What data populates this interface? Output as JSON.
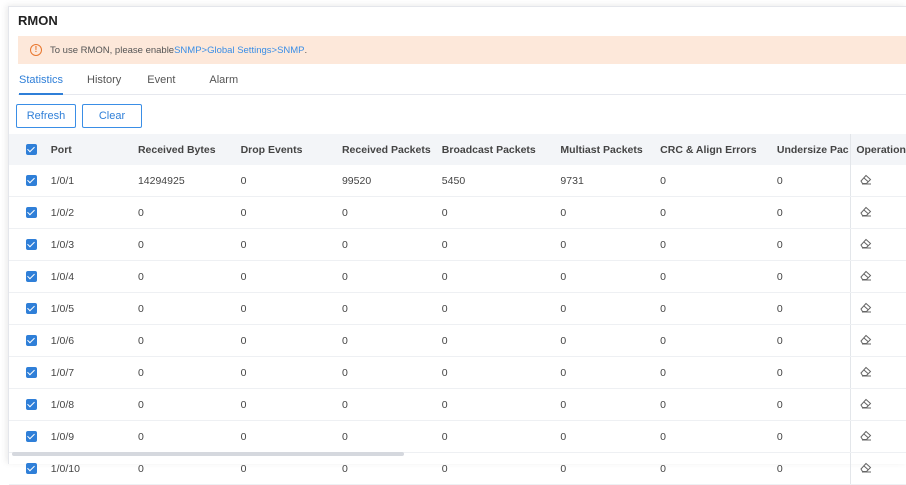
{
  "page": {
    "title": "RMON"
  },
  "notice": {
    "icon": "warning-circle-icon",
    "prefix": "To use RMON, please enable ",
    "link": "SNMP>Global Settings>SNMP",
    "suffix": "."
  },
  "tabs": [
    {
      "label": "Statistics",
      "active": true
    },
    {
      "label": "History",
      "active": false
    },
    {
      "label": "Event",
      "active": false
    },
    {
      "label": "Alarm",
      "active": false
    }
  ],
  "toolbar": {
    "refresh_label": "Refresh",
    "clear_label": "Clear"
  },
  "table": {
    "headers": {
      "port": "Port",
      "received_bytes": "Received Bytes",
      "drop_events": "Drop Events",
      "received_packets": "Received Packets",
      "broadcast_packets": "Broadcast Packets",
      "multicast_packets": "Multiast Packets",
      "crc_align_errors": "CRC & Align Errors",
      "undersize_packets": "Undersize Pac",
      "operation": "Operation"
    },
    "rows": [
      {
        "port": "1/0/1",
        "received_bytes": "14294925",
        "drop_events": "0",
        "received_packets": "99520",
        "broadcast_packets": "5450",
        "multicast_packets": "9731",
        "crc_align_errors": "0",
        "undersize_packets": "0"
      },
      {
        "port": "1/0/2",
        "received_bytes": "0",
        "drop_events": "0",
        "received_packets": "0",
        "broadcast_packets": "0",
        "multicast_packets": "0",
        "crc_align_errors": "0",
        "undersize_packets": "0"
      },
      {
        "port": "1/0/3",
        "received_bytes": "0",
        "drop_events": "0",
        "received_packets": "0",
        "broadcast_packets": "0",
        "multicast_packets": "0",
        "crc_align_errors": "0",
        "undersize_packets": "0"
      },
      {
        "port": "1/0/4",
        "received_bytes": "0",
        "drop_events": "0",
        "received_packets": "0",
        "broadcast_packets": "0",
        "multicast_packets": "0",
        "crc_align_errors": "0",
        "undersize_packets": "0"
      },
      {
        "port": "1/0/5",
        "received_bytes": "0",
        "drop_events": "0",
        "received_packets": "0",
        "broadcast_packets": "0",
        "multicast_packets": "0",
        "crc_align_errors": "0",
        "undersize_packets": "0"
      },
      {
        "port": "1/0/6",
        "received_bytes": "0",
        "drop_events": "0",
        "received_packets": "0",
        "broadcast_packets": "0",
        "multicast_packets": "0",
        "crc_align_errors": "0",
        "undersize_packets": "0"
      },
      {
        "port": "1/0/7",
        "received_bytes": "0",
        "drop_events": "0",
        "received_packets": "0",
        "broadcast_packets": "0",
        "multicast_packets": "0",
        "crc_align_errors": "0",
        "undersize_packets": "0"
      },
      {
        "port": "1/0/8",
        "received_bytes": "0",
        "drop_events": "0",
        "received_packets": "0",
        "broadcast_packets": "0",
        "multicast_packets": "0",
        "crc_align_errors": "0",
        "undersize_packets": "0"
      },
      {
        "port": "1/0/9",
        "received_bytes": "0",
        "drop_events": "0",
        "received_packets": "0",
        "broadcast_packets": "0",
        "multicast_packets": "0",
        "crc_align_errors": "0",
        "undersize_packets": "0"
      },
      {
        "port": "1/0/10",
        "received_bytes": "0",
        "drop_events": "0",
        "received_packets": "0",
        "broadcast_packets": "0",
        "multicast_packets": "0",
        "crc_align_errors": "0",
        "undersize_packets": "0"
      }
    ],
    "operation_icon": "eraser-icon",
    "all_selected": true
  },
  "colors": {
    "accent": "#2f7fd8",
    "notice_bg": "#fde8da",
    "warning": "#e8762d"
  }
}
